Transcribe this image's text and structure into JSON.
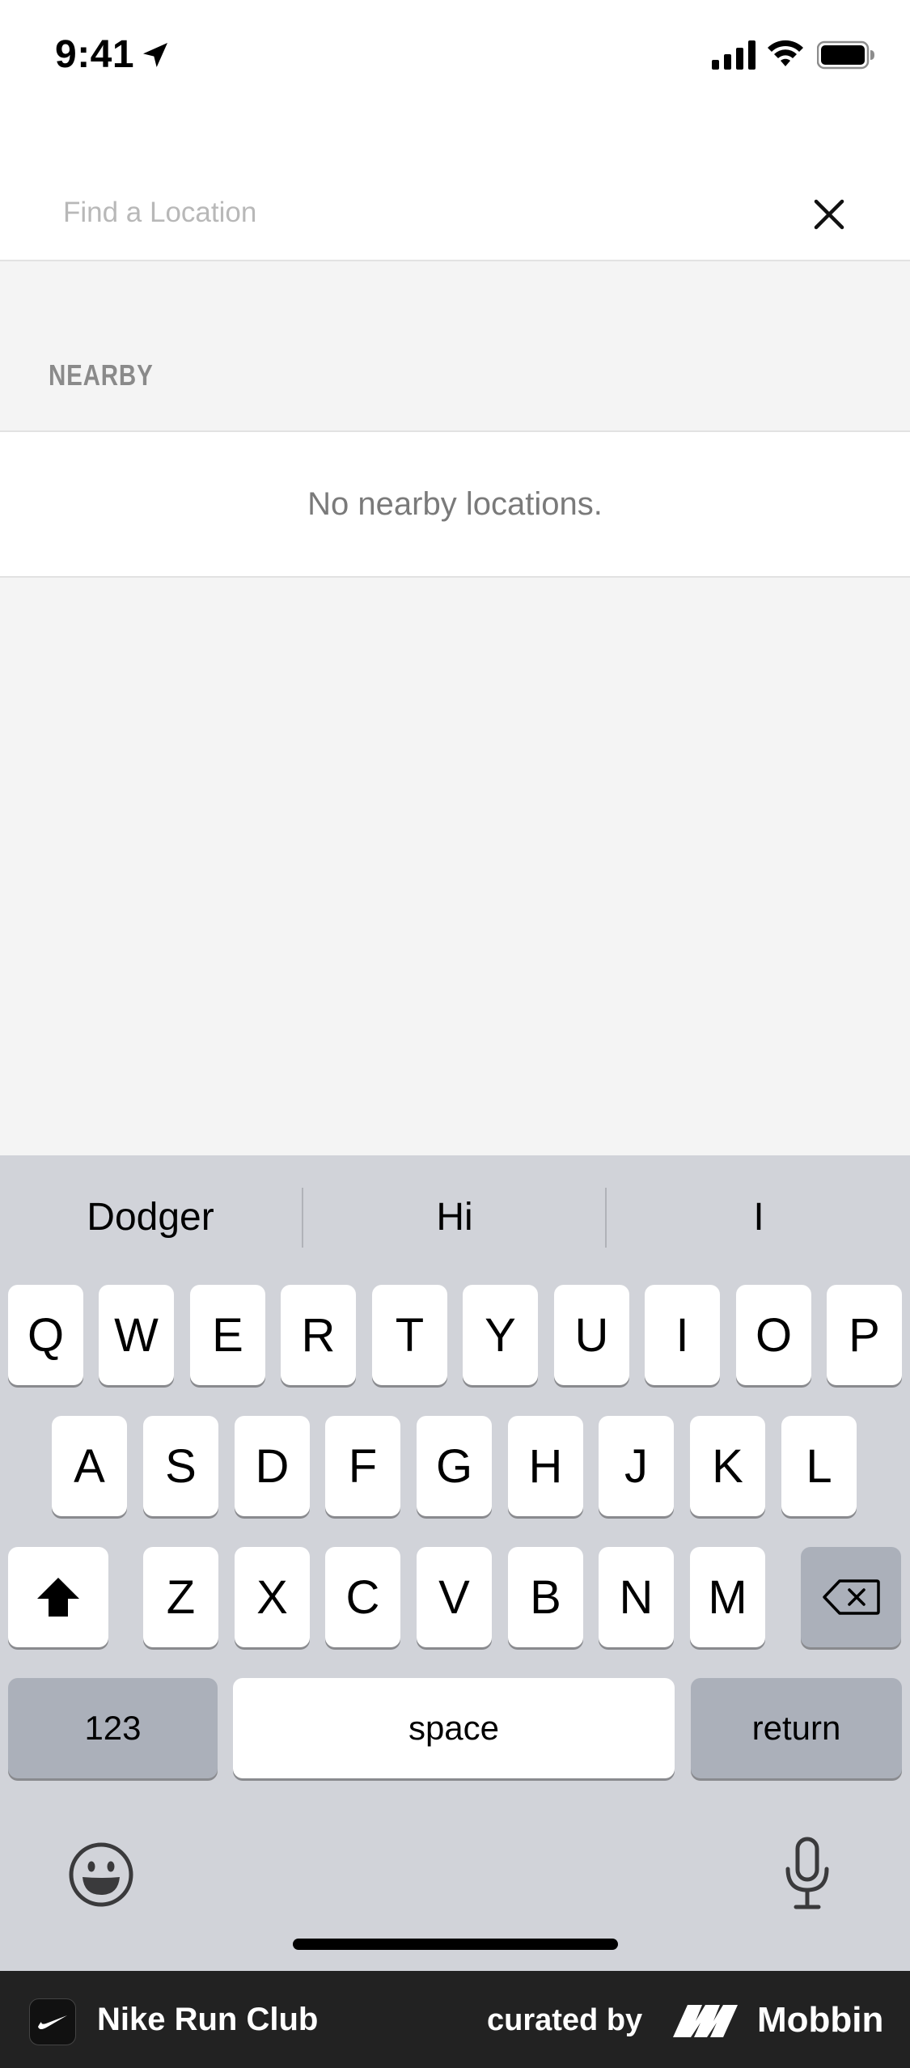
{
  "status_bar": {
    "time": "9:41"
  },
  "search": {
    "placeholder": "Find a Location",
    "value": ""
  },
  "nearby": {
    "section_title": "NEARBY",
    "empty_message": "No nearby locations."
  },
  "keyboard": {
    "suggestions": [
      "Dodger",
      "Hi",
      "I"
    ],
    "row1": [
      "Q",
      "W",
      "E",
      "R",
      "T",
      "Y",
      "U",
      "I",
      "O",
      "P"
    ],
    "row2": [
      "A",
      "S",
      "D",
      "F",
      "G",
      "H",
      "J",
      "K",
      "L"
    ],
    "row3": [
      "Z",
      "X",
      "C",
      "V",
      "B",
      "N",
      "M"
    ],
    "numbers_label": "123",
    "space_label": "space",
    "return_label": "return"
  },
  "footer": {
    "app_name": "Nike Run Club",
    "curated_by": "curated by",
    "brand": "Mobbin"
  },
  "colors": {
    "background": "#f4f4f4",
    "keyboard_bg": "#d1d3d9",
    "footer_bg": "#222222"
  }
}
